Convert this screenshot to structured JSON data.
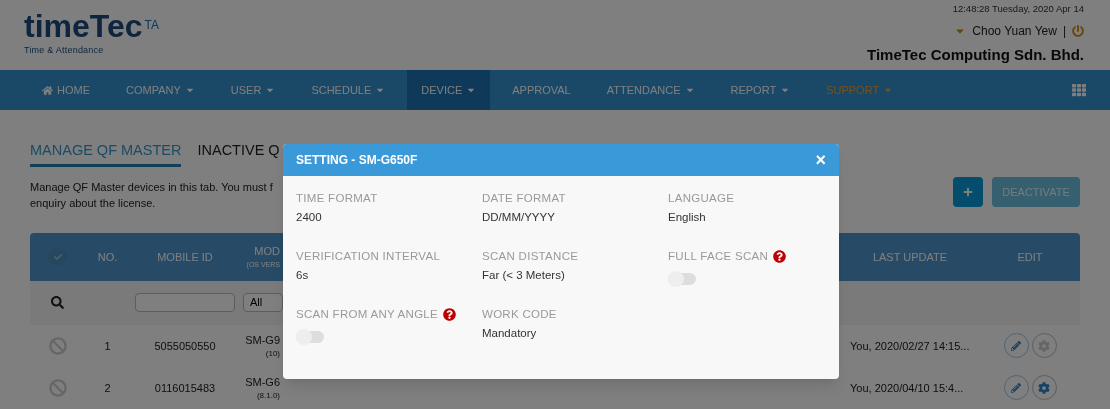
{
  "header": {
    "logo": {
      "name": "timeTec",
      "badge": "TA",
      "tagline": "Time & Attendance"
    },
    "datetime": "12:48:28 Tuesday, 2020 Apr 14",
    "user": "Choo Yuan Yew",
    "separator": "|",
    "company": "TimeTec Computing Sdn. Bhd."
  },
  "nav": [
    {
      "kind": "home",
      "label": "HOME",
      "dropdown": false,
      "selected": false
    },
    {
      "kind": "menu",
      "label": "COMPANY",
      "dropdown": true,
      "selected": false
    },
    {
      "kind": "menu",
      "label": "USER",
      "dropdown": true,
      "selected": false
    },
    {
      "kind": "menu",
      "label": "SCHEDULE",
      "dropdown": true,
      "selected": false
    },
    {
      "kind": "menu",
      "label": "DEVICE",
      "dropdown": true,
      "selected": true
    },
    {
      "kind": "menu",
      "label": "APPROVAL",
      "dropdown": false,
      "selected": false
    },
    {
      "kind": "menu",
      "label": "ATTENDANCE",
      "dropdown": true,
      "selected": false
    },
    {
      "kind": "menu",
      "label": "REPORT",
      "dropdown": true,
      "selected": false
    },
    {
      "kind": "support",
      "label": "SUPPORT",
      "dropdown": true,
      "selected": false
    }
  ],
  "tabs": [
    {
      "label": "MANAGE QF MASTER",
      "selected": true
    },
    {
      "label": "INACTIVE Q",
      "selected": false
    }
  ],
  "description": [
    "Manage QF Master devices in this tab. You must f",
    "enquiry about the license."
  ],
  "actions": {
    "deactivate": {
      "label": "DEACTIVATE",
      "disabled": true
    }
  },
  "table": {
    "select_all": {
      "checked": false
    },
    "columns": [
      "NO.",
      "MOBILE ID",
      "MOD",
      "LAST UPDATE",
      "EDIT"
    ],
    "model_subheading": "(OS VERS",
    "filter": {
      "select": "All"
    },
    "rows": [
      {
        "no": "1",
        "mobile_id": "5055050550",
        "model": "SM-G9",
        "os": "(10)",
        "last_update": "You, 2020/02/27 14:15...",
        "settings_enabled": false
      },
      {
        "no": "2",
        "mobile_id": "0116015483",
        "model": "SM-G6",
        "os": "(8.1.0)",
        "last_update": "You, 2020/04/10 15:4...",
        "settings_enabled": true
      }
    ]
  },
  "modal": {
    "title": "SETTING - SM-G650F",
    "close": "×",
    "fields": [
      {
        "kind": "text",
        "label": "TIME FORMAT",
        "value": "2400"
      },
      {
        "kind": "text",
        "label": "DATE FORMAT",
        "value": "DD/MM/YYYY"
      },
      {
        "kind": "text",
        "label": "LANGUAGE",
        "value": "English"
      },
      {
        "kind": "text",
        "label": "VERIFICATION INTERVAL",
        "value": "6s"
      },
      {
        "kind": "text",
        "label": "SCAN DISTANCE",
        "value": "Far (< 3 Meters)"
      },
      {
        "kind": "toggle",
        "label": "FULL FACE SCAN",
        "help": true,
        "on": false
      },
      {
        "kind": "toggle",
        "label": "SCAN FROM ANY ANGLE",
        "help": true,
        "on": false
      },
      {
        "kind": "text",
        "label": "WORK CODE",
        "value": "Mandatory"
      }
    ]
  }
}
